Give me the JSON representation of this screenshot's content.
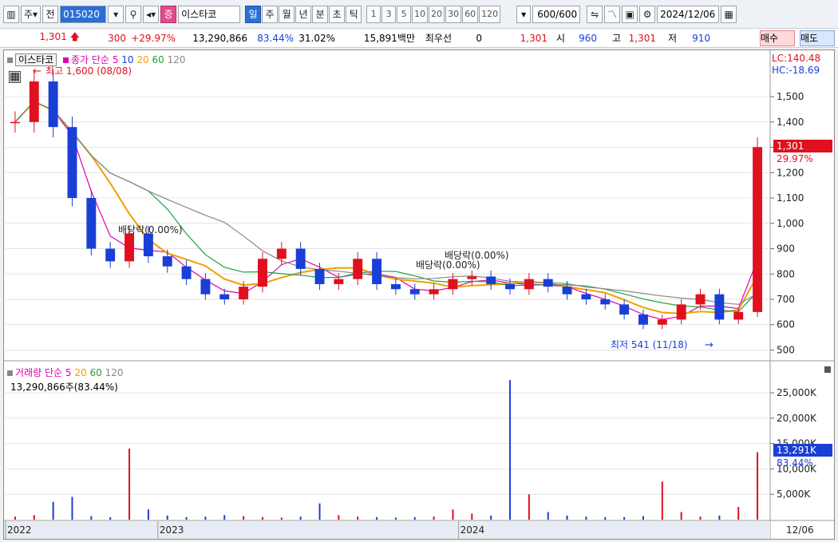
{
  "toolbar": {
    "market_label": "주",
    "prev_label": "전",
    "stock_code": "015020",
    "badge_label": "증",
    "stock_name": "이스타코",
    "periods": [
      "일",
      "주",
      "월",
      "년",
      "분",
      "초",
      "틱"
    ],
    "selected_period": "일",
    "intervals": [
      "1",
      "3",
      "5",
      "10",
      "20",
      "30",
      "60",
      "120"
    ],
    "count_value": "600",
    "count_total": "/600",
    "date_value": "2024/12/06"
  },
  "info": {
    "price": "1,301",
    "change": "300",
    "change_pct": "+29.97%",
    "volume": "13,290,866",
    "volume_ratio": "83.44%",
    "turnover": "31.02%",
    "amount": "15,891백만",
    "pref_label": "최우선",
    "pref_value": "0",
    "pref_price": "1,301",
    "open_label": "시",
    "open_value": "960",
    "high_label": "고",
    "high_value": "1,301",
    "low_label": "저",
    "low_value": "910",
    "buy_label": "매수",
    "sell_label": "매도"
  },
  "price_panel": {
    "title": "이스타코",
    "legend_prefix": "종가 단순",
    "ma_periods": [
      "5",
      "10",
      "20",
      "60",
      "120"
    ],
    "lc_label": "LC:140.48",
    "hc_label": "HC:-18.69",
    "high_annotation": "최고 1,600 (08/08)",
    "low_annotation": "최저 541 (11/18)",
    "dividend_labels": [
      "배당락(0.00%)",
      "배당락(0.00%)",
      "배당락(0.00%)"
    ],
    "current_price_tag": "1,301",
    "current_pct_tag": "29.97%",
    "y_ticks": [
      "1,500",
      "1,400",
      "1,300",
      "1,200",
      "1,100",
      "1,000",
      "900",
      "800",
      "700",
      "600",
      "500"
    ]
  },
  "volume_panel": {
    "title": "거래량",
    "legend_prefix": "단순",
    "ma_periods": [
      "5",
      "20",
      "60",
      "120"
    ],
    "summary": "13,290,866주(83.44%)",
    "current_tag": "13,291K",
    "current_pct": "83.44%",
    "y_ticks": [
      "25,000K",
      "20,000K",
      "15,000K",
      "10,000K",
      "5,000K"
    ]
  },
  "x_axis": {
    "labels": [
      "2022",
      "2023",
      "2024"
    ],
    "right_label": "12/06"
  },
  "colors": {
    "up": "#e0101e",
    "down": "#1a3fd6",
    "ma5": "#e000b0",
    "ma10": "#1a3fd6",
    "ma20": "#f0a000",
    "ma60": "#20a040",
    "ma120": "#888888"
  },
  "chart_data": {
    "type": "line",
    "title": "이스타코",
    "ylabel": "",
    "ylim": [
      470,
      1620
    ],
    "x": [
      "2022",
      "2023",
      "2024",
      "12/06"
    ],
    "series": [
      {
        "name": "종가",
        "values": [
          1400,
          1560,
          1380,
          1100,
          900,
          850,
          960,
          870,
          830,
          780,
          720,
          700,
          750,
          860,
          900,
          820,
          760,
          780,
          860,
          760,
          740,
          720,
          740,
          780,
          790,
          760,
          740,
          780,
          750,
          720,
          700,
          680,
          640,
          600,
          620,
          680,
          720,
          620,
          650,
          1301
        ]
      }
    ],
    "volume_ylim": [
      0,
      28000
    ],
    "volume_values": [
      600,
      900,
      3500,
      4500,
      700,
      500,
      14000,
      2000,
      800,
      500,
      600,
      900,
      700,
      500,
      400,
      600,
      3200,
      900,
      600,
      500,
      400,
      500,
      600,
      2000,
      1200,
      800,
      27500,
      5000,
      1500,
      800,
      600,
      500,
      500,
      700,
      7500,
      1500,
      600,
      800,
      2500,
      13291
    ]
  }
}
